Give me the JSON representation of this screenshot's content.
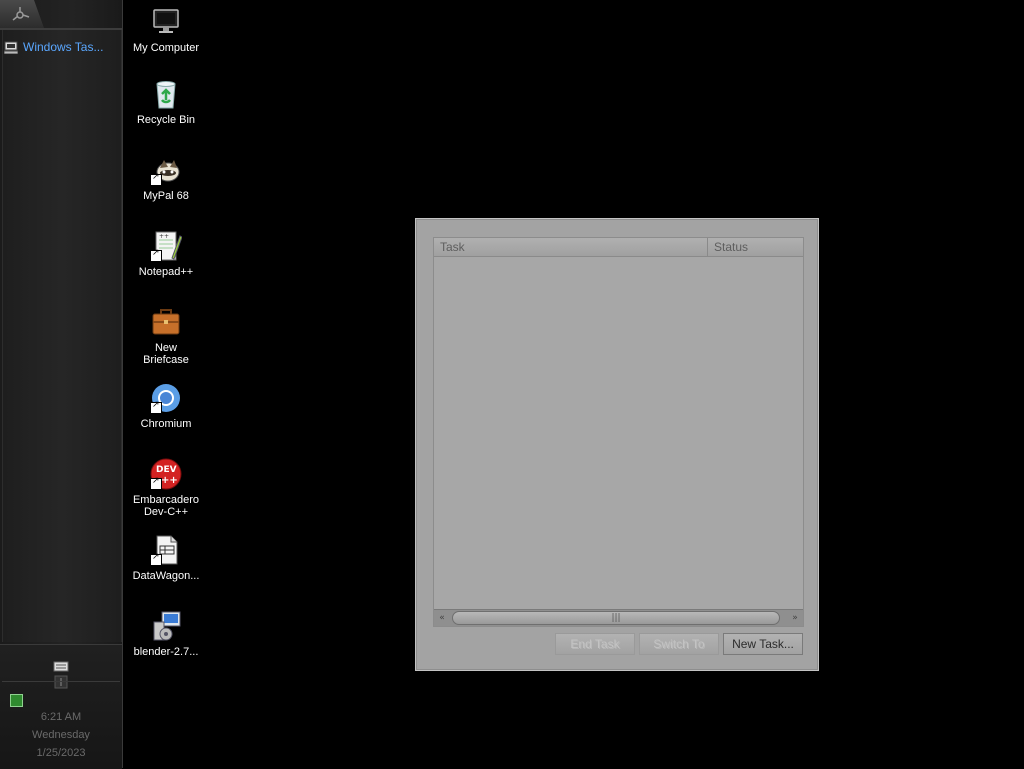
{
  "taskbar": {
    "tasks": [
      {
        "label": "Windows Tas..."
      }
    ],
    "clock": {
      "time": "6:21 AM",
      "day": "Wednesday",
      "date": "1/25/2023"
    }
  },
  "desktop": {
    "icons": [
      {
        "label": "My Computer",
        "icon": "computer-icon"
      },
      {
        "label": "Recycle Bin",
        "icon": "recycle-bin-icon"
      },
      {
        "label": "MyPal 68",
        "icon": "mypal-icon"
      },
      {
        "label": "Notepad++",
        "icon": "notepad-plus-plus-icon"
      },
      {
        "label": "New Briefcase",
        "icon": "briefcase-icon"
      },
      {
        "label": "Chromium",
        "icon": "chromium-icon"
      },
      {
        "label": "Embarcadero Dev-C++",
        "icon": "dev-cpp-icon"
      },
      {
        "label": "DataWagon...",
        "icon": "document-icon"
      },
      {
        "label": "blender-2.7...",
        "icon": "installer-icon"
      }
    ]
  },
  "task_manager": {
    "columns": [
      "Task",
      "Status"
    ],
    "rows": [],
    "buttons": {
      "end_task": "End Task",
      "switch_to": "Switch To",
      "new_task": "New Task..."
    },
    "scroll_thumb_grip": "|||"
  },
  "colors": {
    "desktop_bg": "#000000",
    "taskbar_bg": "#222222",
    "task_link": "#5aa7ff",
    "window_bg": "#a3a3a3"
  }
}
